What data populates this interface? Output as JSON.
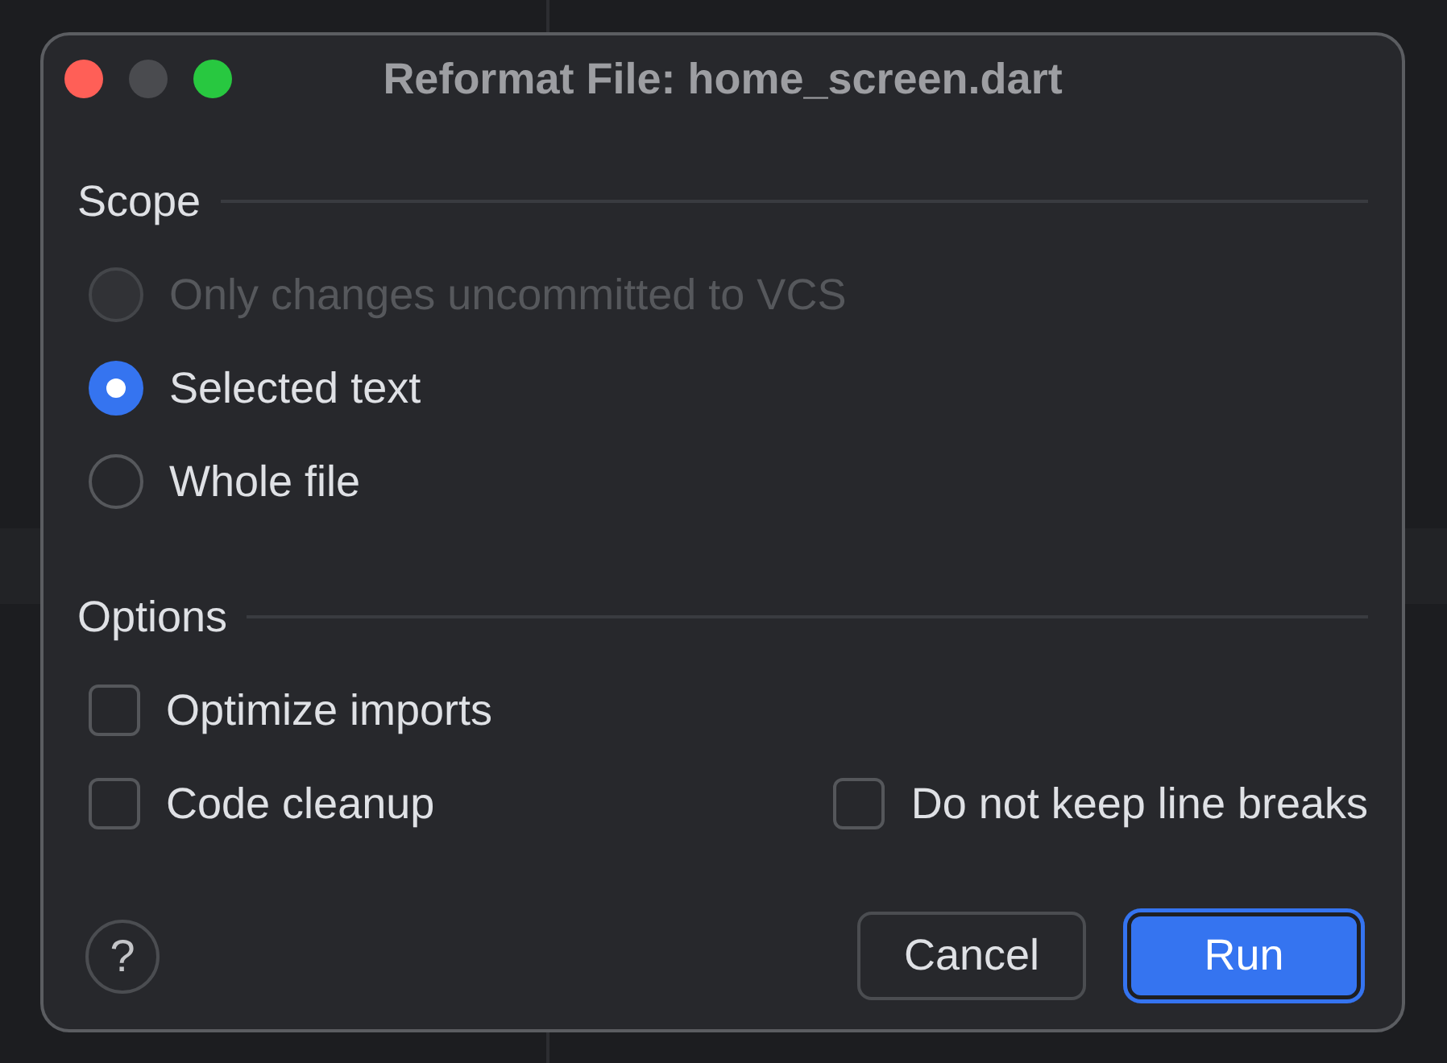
{
  "window": {
    "title": "Reformat File: home_screen.dart",
    "controls": [
      {
        "kind": "close",
        "disabled": false
      },
      {
        "kind": "minimize",
        "disabled": true
      },
      {
        "kind": "zoom",
        "disabled": false
      }
    ]
  },
  "scope": {
    "heading": "Scope",
    "options": [
      {
        "label": "Only changes uncommitted to VCS",
        "selected": false,
        "disabled": true
      },
      {
        "label": "Selected text",
        "selected": true,
        "disabled": false
      },
      {
        "label": "Whole file",
        "selected": false,
        "disabled": false
      }
    ]
  },
  "options": {
    "heading": "Options",
    "checkboxes": [
      {
        "label": "Optimize imports",
        "checked": false
      },
      {
        "label": "Code cleanup",
        "checked": false
      },
      {
        "label": "Do not keep line breaks",
        "checked": false
      }
    ]
  },
  "help": {
    "label": "?"
  },
  "buttons": [
    {
      "label": "Cancel",
      "kind": "secondary"
    },
    {
      "label": "Run",
      "kind": "primary"
    }
  ]
}
